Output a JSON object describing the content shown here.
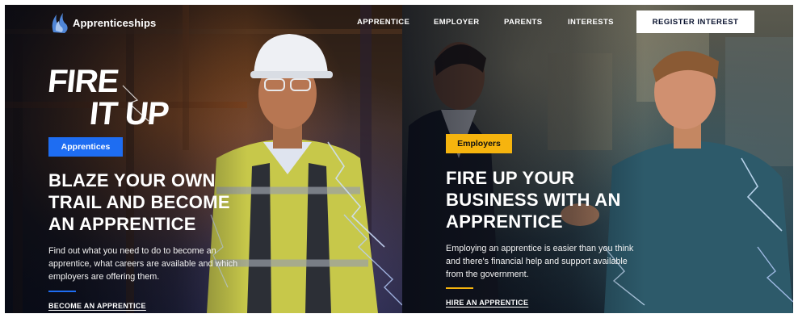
{
  "header": {
    "logo_text": "Apprenticeships",
    "nav": [
      "APPRENTICE",
      "EMPLOYER",
      "PARENTS",
      "INTERESTS"
    ],
    "register_label": "REGISTER INTEREST"
  },
  "hero_logo": {
    "line1": "FIRE",
    "line2": "IT UP"
  },
  "apprentices": {
    "badge": "Apprentices",
    "headline_lines": [
      "BLAZE YOUR OWN",
      "TRAIL AND BECOME",
      "AN APPRENTICE"
    ],
    "body_lines": [
      "Find out what you need to do to become an",
      "apprentice, what careers are available and which",
      "employers are offering them."
    ],
    "cta": "BECOME AN APPRENTICE"
  },
  "employers": {
    "badge": "Employers",
    "headline_lines": [
      "FIRE UP YOUR",
      "BUSINESS WITH AN",
      "APPRENTICE"
    ],
    "body_lines": [
      "Employing an apprentice is easier than you think",
      "and there's financial help and support available",
      "from the government."
    ],
    "cta": "HIRE AN APPRENTICE"
  },
  "colors": {
    "apprentice_accent": "#1e6df2",
    "employer_accent": "#f6b40e"
  },
  "icons": {
    "logo": "apprenticeships-flame-icon"
  }
}
